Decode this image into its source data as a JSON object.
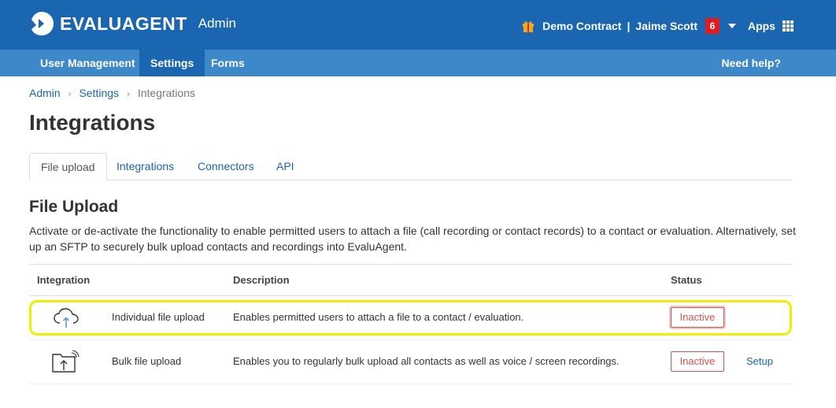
{
  "header": {
    "brand_name": "EVALUAGENT",
    "brand_sub": "Admin",
    "contract": "Demo Contract",
    "separator": "|",
    "user_name": "Jaime Scott",
    "notification_count": "6",
    "apps_label": "Apps"
  },
  "nav": {
    "items": [
      {
        "label": "User Management"
      },
      {
        "label": "Settings"
      },
      {
        "label": "Forms"
      }
    ],
    "help_label": "Need help?"
  },
  "breadcrumb": {
    "items": [
      "Admin",
      "Settings",
      "Integrations"
    ],
    "separator": "›"
  },
  "page_title": "Integrations",
  "tabs": [
    {
      "label": "File upload"
    },
    {
      "label": "Integrations"
    },
    {
      "label": "Connectors"
    },
    {
      "label": "API"
    }
  ],
  "section": {
    "title": "File Upload",
    "description": "Activate or de-activate the functionality to enable permitted users to attach a file (call recording or contact records) to a contact or evaluation. Alternatively, set up an SFTP to securely bulk upload contacts and recordings into EvaluAgent."
  },
  "table": {
    "headers": [
      "Integration",
      "Description",
      "Status"
    ],
    "rows": [
      {
        "icon": "cloud-upload-icon",
        "name": "Individual file upload",
        "description": "Enables permitted users to attach a file to a contact / evaluation.",
        "status": "Inactive",
        "action": ""
      },
      {
        "icon": "folder-upload-icon",
        "name": "Bulk file upload",
        "description": "Enables you to regularly bulk upload all contacts as well as voice / screen recordings.",
        "status": "Inactive",
        "action": "Setup"
      }
    ]
  },
  "colors": {
    "header_bg": "#1a66b0",
    "nav_bg": "#3c88c9",
    "inactive": "#d9534f",
    "highlight": "#f2ee00"
  }
}
